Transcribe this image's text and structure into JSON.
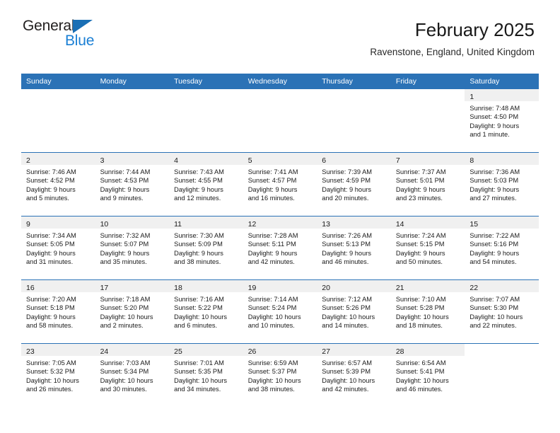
{
  "brand": {
    "name_part1": "General",
    "name_part2": "Blue",
    "triangle_color": "#1a6fb5",
    "blue_color": "#1a7fd4"
  },
  "header": {
    "title": "February 2025",
    "subtitle": "Ravenstone, England, United Kingdom"
  },
  "theme": {
    "header_blue": "#2b72b6",
    "daynum_band": "#f0f0f0",
    "text": "#1a1a1a"
  },
  "weekday_headers": [
    "Sunday",
    "Monday",
    "Tuesday",
    "Wednesday",
    "Thursday",
    "Friday",
    "Saturday"
  ],
  "weeks": [
    [
      {
        "day": "",
        "sunrise": "",
        "sunset": "",
        "daylight_l1": "",
        "daylight_l2": ""
      },
      {
        "day": "",
        "sunrise": "",
        "sunset": "",
        "daylight_l1": "",
        "daylight_l2": ""
      },
      {
        "day": "",
        "sunrise": "",
        "sunset": "",
        "daylight_l1": "",
        "daylight_l2": ""
      },
      {
        "day": "",
        "sunrise": "",
        "sunset": "",
        "daylight_l1": "",
        "daylight_l2": ""
      },
      {
        "day": "",
        "sunrise": "",
        "sunset": "",
        "daylight_l1": "",
        "daylight_l2": ""
      },
      {
        "day": "",
        "sunrise": "",
        "sunset": "",
        "daylight_l1": "",
        "daylight_l2": ""
      },
      {
        "day": "1",
        "sunrise": "Sunrise: 7:48 AM",
        "sunset": "Sunset: 4:50 PM",
        "daylight_l1": "Daylight: 9 hours",
        "daylight_l2": "and 1 minute."
      }
    ],
    [
      {
        "day": "2",
        "sunrise": "Sunrise: 7:46 AM",
        "sunset": "Sunset: 4:52 PM",
        "daylight_l1": "Daylight: 9 hours",
        "daylight_l2": "and 5 minutes."
      },
      {
        "day": "3",
        "sunrise": "Sunrise: 7:44 AM",
        "sunset": "Sunset: 4:53 PM",
        "daylight_l1": "Daylight: 9 hours",
        "daylight_l2": "and 9 minutes."
      },
      {
        "day": "4",
        "sunrise": "Sunrise: 7:43 AM",
        "sunset": "Sunset: 4:55 PM",
        "daylight_l1": "Daylight: 9 hours",
        "daylight_l2": "and 12 minutes."
      },
      {
        "day": "5",
        "sunrise": "Sunrise: 7:41 AM",
        "sunset": "Sunset: 4:57 PM",
        "daylight_l1": "Daylight: 9 hours",
        "daylight_l2": "and 16 minutes."
      },
      {
        "day": "6",
        "sunrise": "Sunrise: 7:39 AM",
        "sunset": "Sunset: 4:59 PM",
        "daylight_l1": "Daylight: 9 hours",
        "daylight_l2": "and 20 minutes."
      },
      {
        "day": "7",
        "sunrise": "Sunrise: 7:37 AM",
        "sunset": "Sunset: 5:01 PM",
        "daylight_l1": "Daylight: 9 hours",
        "daylight_l2": "and 23 minutes."
      },
      {
        "day": "8",
        "sunrise": "Sunrise: 7:36 AM",
        "sunset": "Sunset: 5:03 PM",
        "daylight_l1": "Daylight: 9 hours",
        "daylight_l2": "and 27 minutes."
      }
    ],
    [
      {
        "day": "9",
        "sunrise": "Sunrise: 7:34 AM",
        "sunset": "Sunset: 5:05 PM",
        "daylight_l1": "Daylight: 9 hours",
        "daylight_l2": "and 31 minutes."
      },
      {
        "day": "10",
        "sunrise": "Sunrise: 7:32 AM",
        "sunset": "Sunset: 5:07 PM",
        "daylight_l1": "Daylight: 9 hours",
        "daylight_l2": "and 35 minutes."
      },
      {
        "day": "11",
        "sunrise": "Sunrise: 7:30 AM",
        "sunset": "Sunset: 5:09 PM",
        "daylight_l1": "Daylight: 9 hours",
        "daylight_l2": "and 38 minutes."
      },
      {
        "day": "12",
        "sunrise": "Sunrise: 7:28 AM",
        "sunset": "Sunset: 5:11 PM",
        "daylight_l1": "Daylight: 9 hours",
        "daylight_l2": "and 42 minutes."
      },
      {
        "day": "13",
        "sunrise": "Sunrise: 7:26 AM",
        "sunset": "Sunset: 5:13 PM",
        "daylight_l1": "Daylight: 9 hours",
        "daylight_l2": "and 46 minutes."
      },
      {
        "day": "14",
        "sunrise": "Sunrise: 7:24 AM",
        "sunset": "Sunset: 5:15 PM",
        "daylight_l1": "Daylight: 9 hours",
        "daylight_l2": "and 50 minutes."
      },
      {
        "day": "15",
        "sunrise": "Sunrise: 7:22 AM",
        "sunset": "Sunset: 5:16 PM",
        "daylight_l1": "Daylight: 9 hours",
        "daylight_l2": "and 54 minutes."
      }
    ],
    [
      {
        "day": "16",
        "sunrise": "Sunrise: 7:20 AM",
        "sunset": "Sunset: 5:18 PM",
        "daylight_l1": "Daylight: 9 hours",
        "daylight_l2": "and 58 minutes."
      },
      {
        "day": "17",
        "sunrise": "Sunrise: 7:18 AM",
        "sunset": "Sunset: 5:20 PM",
        "daylight_l1": "Daylight: 10 hours",
        "daylight_l2": "and 2 minutes."
      },
      {
        "day": "18",
        "sunrise": "Sunrise: 7:16 AM",
        "sunset": "Sunset: 5:22 PM",
        "daylight_l1": "Daylight: 10 hours",
        "daylight_l2": "and 6 minutes."
      },
      {
        "day": "19",
        "sunrise": "Sunrise: 7:14 AM",
        "sunset": "Sunset: 5:24 PM",
        "daylight_l1": "Daylight: 10 hours",
        "daylight_l2": "and 10 minutes."
      },
      {
        "day": "20",
        "sunrise": "Sunrise: 7:12 AM",
        "sunset": "Sunset: 5:26 PM",
        "daylight_l1": "Daylight: 10 hours",
        "daylight_l2": "and 14 minutes."
      },
      {
        "day": "21",
        "sunrise": "Sunrise: 7:10 AM",
        "sunset": "Sunset: 5:28 PM",
        "daylight_l1": "Daylight: 10 hours",
        "daylight_l2": "and 18 minutes."
      },
      {
        "day": "22",
        "sunrise": "Sunrise: 7:07 AM",
        "sunset": "Sunset: 5:30 PM",
        "daylight_l1": "Daylight: 10 hours",
        "daylight_l2": "and 22 minutes."
      }
    ],
    [
      {
        "day": "23",
        "sunrise": "Sunrise: 7:05 AM",
        "sunset": "Sunset: 5:32 PM",
        "daylight_l1": "Daylight: 10 hours",
        "daylight_l2": "and 26 minutes."
      },
      {
        "day": "24",
        "sunrise": "Sunrise: 7:03 AM",
        "sunset": "Sunset: 5:34 PM",
        "daylight_l1": "Daylight: 10 hours",
        "daylight_l2": "and 30 minutes."
      },
      {
        "day": "25",
        "sunrise": "Sunrise: 7:01 AM",
        "sunset": "Sunset: 5:35 PM",
        "daylight_l1": "Daylight: 10 hours",
        "daylight_l2": "and 34 minutes."
      },
      {
        "day": "26",
        "sunrise": "Sunrise: 6:59 AM",
        "sunset": "Sunset: 5:37 PM",
        "daylight_l1": "Daylight: 10 hours",
        "daylight_l2": "and 38 minutes."
      },
      {
        "day": "27",
        "sunrise": "Sunrise: 6:57 AM",
        "sunset": "Sunset: 5:39 PM",
        "daylight_l1": "Daylight: 10 hours",
        "daylight_l2": "and 42 minutes."
      },
      {
        "day": "28",
        "sunrise": "Sunrise: 6:54 AM",
        "sunset": "Sunset: 5:41 PM",
        "daylight_l1": "Daylight: 10 hours",
        "daylight_l2": "and 46 minutes."
      },
      {
        "day": "",
        "sunrise": "",
        "sunset": "",
        "daylight_l1": "",
        "daylight_l2": ""
      }
    ]
  ]
}
